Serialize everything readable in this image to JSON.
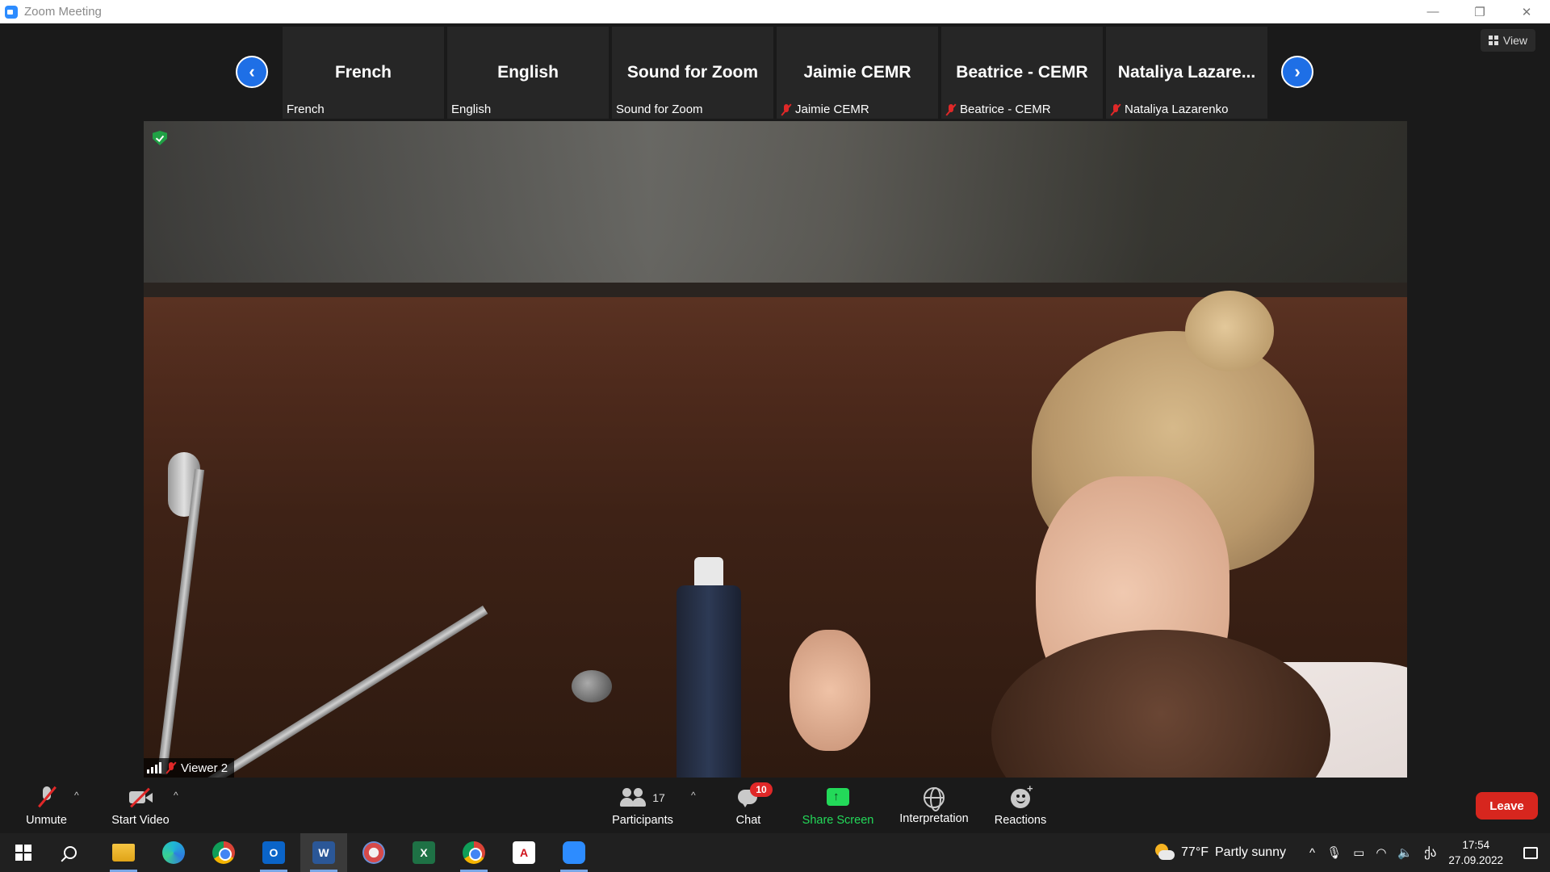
{
  "window": {
    "title": "Zoom Meeting",
    "controls": {
      "minimize": "—",
      "restore": "❐",
      "close": "✕"
    }
  },
  "view_button": {
    "label": "View"
  },
  "nav": {
    "prev": "‹",
    "next": "›"
  },
  "participant_strip": [
    {
      "big_name": "French",
      "label": "French",
      "muted": false
    },
    {
      "big_name": "English",
      "label": "English",
      "muted": false
    },
    {
      "big_name": "Sound for Zoom",
      "label": "Sound for Zoom",
      "muted": false
    },
    {
      "big_name": "Jaimie CEMR",
      "label": "Jaimie CEMR",
      "muted": true
    },
    {
      "big_name": "Beatrice - CEMR",
      "label": "Beatrice - CEMR",
      "muted": true
    },
    {
      "big_name": "Nataliya  Lazare...",
      "label": "Nataliya Lazarenko",
      "muted": true
    }
  ],
  "main_video": {
    "speaker_label": "Viewer 2",
    "muted": true,
    "encrypted": true
  },
  "toolbar": {
    "unmute": "Unmute",
    "start_video": "Start Video",
    "participants": "Participants",
    "participants_count": "17",
    "chat": "Chat",
    "chat_badge": "10",
    "share_screen": "Share Screen",
    "interpretation": "Interpretation",
    "reactions": "Reactions",
    "leave": "Leave",
    "caret": "^"
  },
  "taskbar": {
    "apps": [
      "start-button",
      "search",
      "file-explorer",
      "edge",
      "chrome",
      "outlook",
      "word",
      "snipping-tool",
      "excel",
      "chrome-2",
      "acrobat",
      "zoom"
    ],
    "outlook_letter": "O",
    "word_letter": "W",
    "excel_letter": "X",
    "pdf_letter": "A"
  },
  "tray": {
    "temperature": "77°F",
    "weather": "Partly sunny",
    "chevron": "^",
    "language": "ქა",
    "time": "17:54",
    "date": "27.09.2022"
  },
  "colors": {
    "accent": "#2d8cff",
    "share_green": "#23d959",
    "leave_red": "#d7261e",
    "muted_red": "#e02828"
  }
}
